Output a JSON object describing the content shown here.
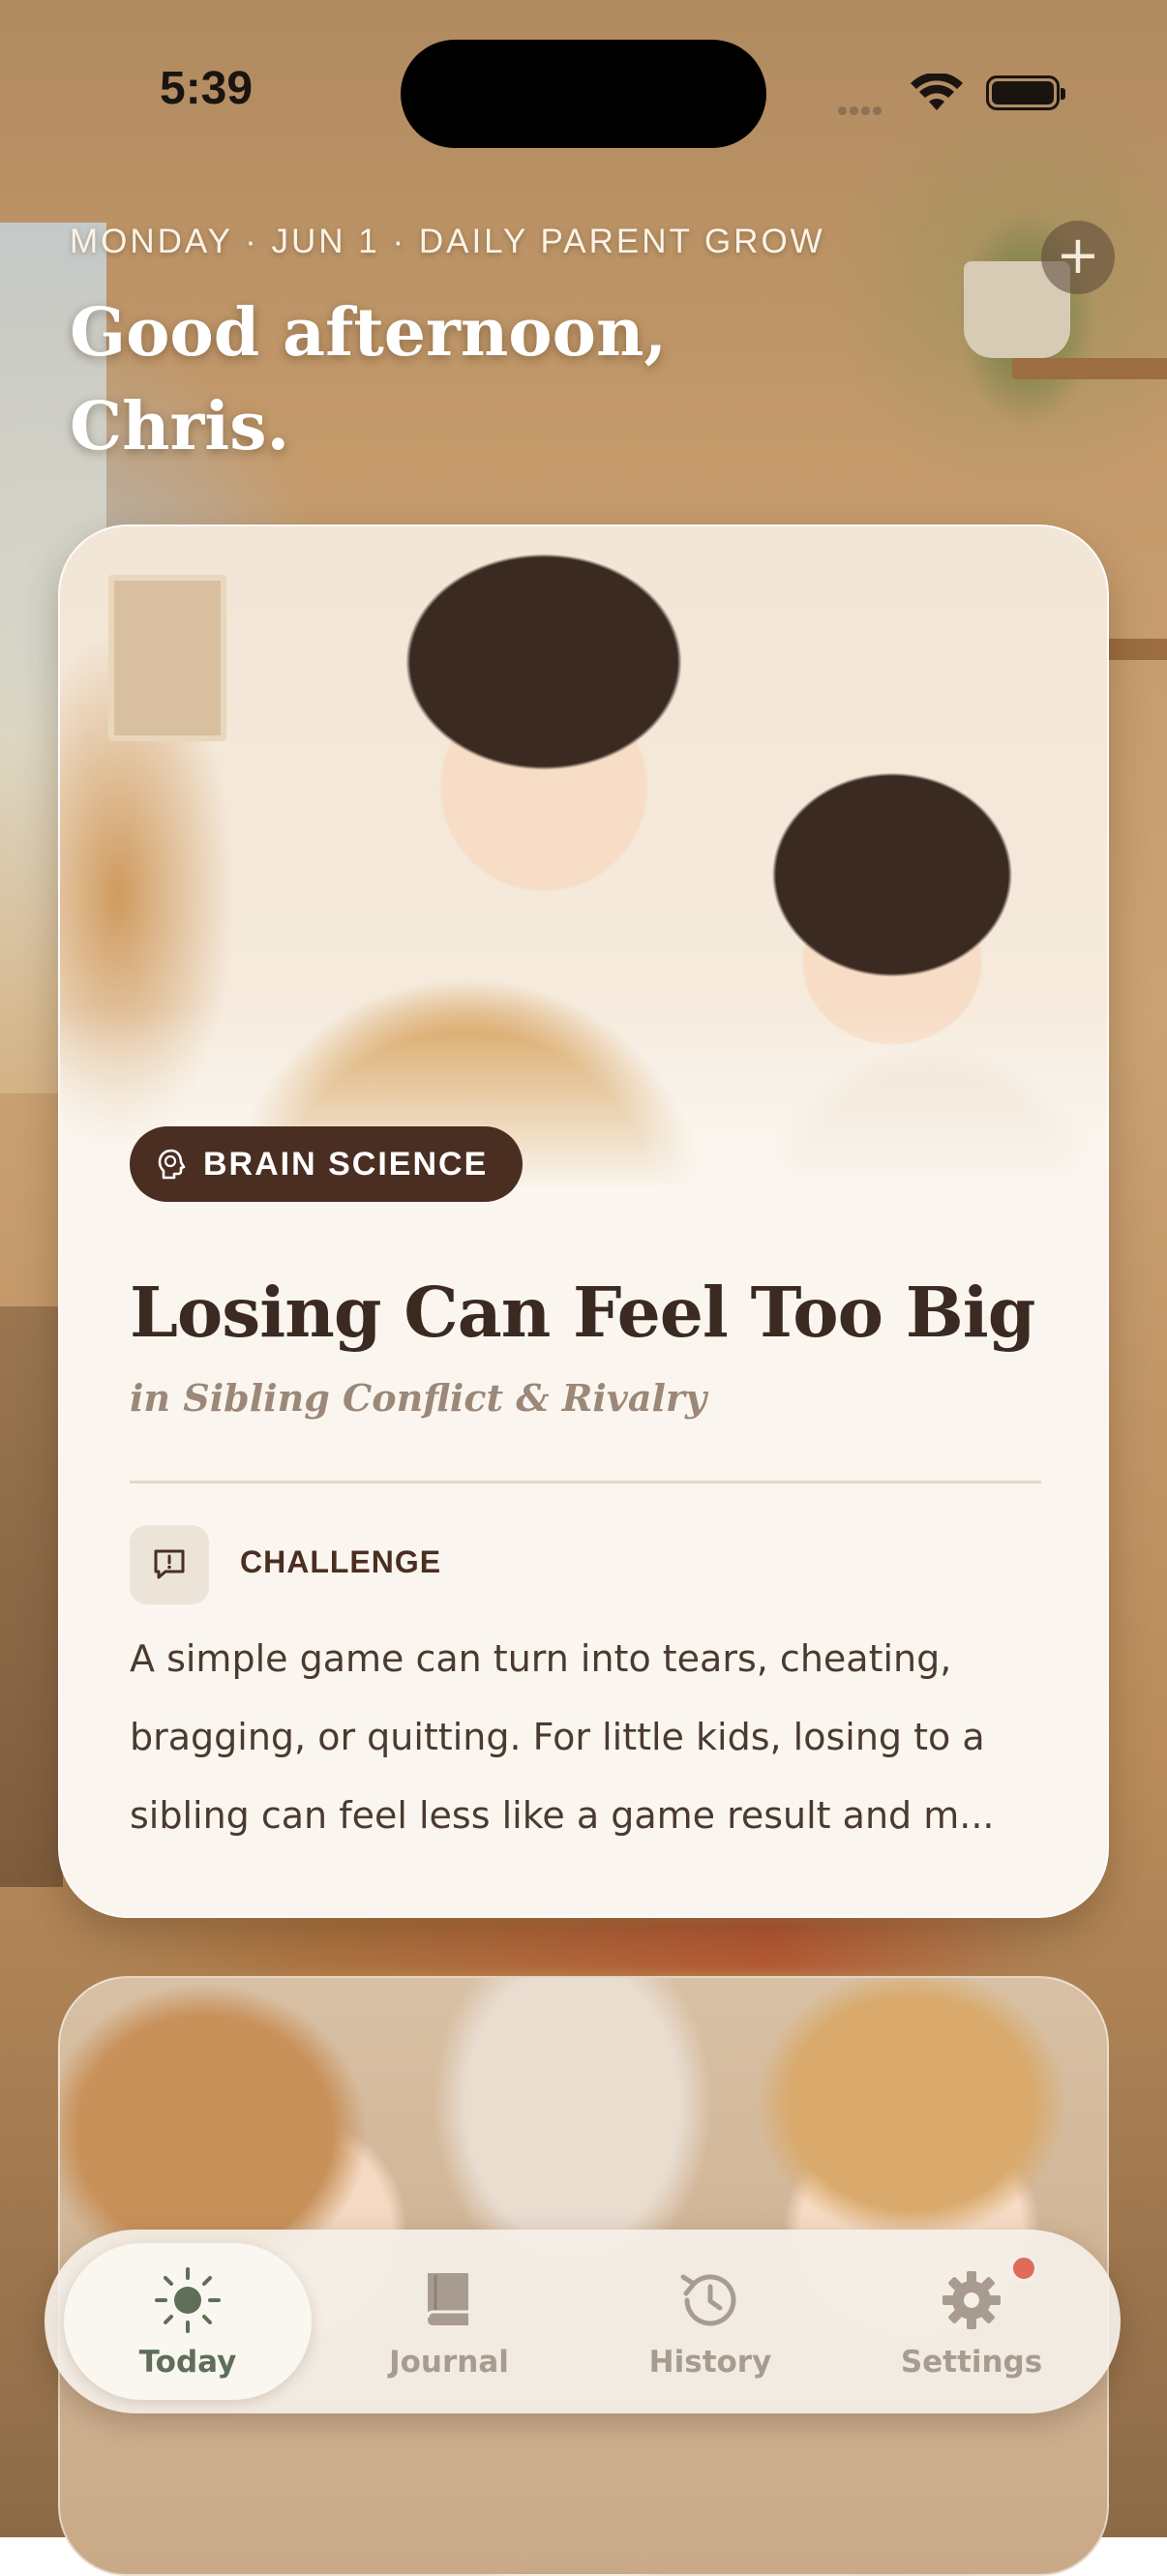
{
  "status_bar": {
    "time": "5:39"
  },
  "header": {
    "date_line": "MONDAY · JUN 1 · DAILY PARENT GROW",
    "greeting_line1": "Good afternoon,",
    "greeting_line2": "Chris.",
    "add_icon": "plus-icon"
  },
  "card": {
    "category": "BRAIN SCIENCE",
    "category_icon": "brain-head-icon",
    "title": "Losing Can Feel Too Big",
    "subtitle": "in Sibling Conflict & Rivalry",
    "section_label": "CHALLENGE",
    "section_icon": "alert-message-icon",
    "body_lines": [
      "A simple game can turn into tears, cheating,",
      "bragging, or quitting. For little kids, losing to a",
      "sibling can feel less like a game result and m..."
    ]
  },
  "tabs": [
    {
      "label": "Today",
      "icon": "sun-icon",
      "active": true
    },
    {
      "label": "Journal",
      "icon": "book-icon",
      "active": false
    },
    {
      "label": "History",
      "icon": "history-clock-icon",
      "active": false
    },
    {
      "label": "Settings",
      "icon": "gear-icon",
      "active": false,
      "badge": true
    }
  ],
  "colors": {
    "accent_green": "#5f6e58",
    "pill_brown": "#4a2e22",
    "badge_red": "#e06b5b",
    "card_bg": "#faf6ef"
  }
}
